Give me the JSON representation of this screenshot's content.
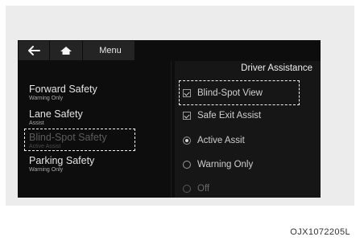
{
  "topbar": {
    "back_icon": "back-arrow-icon",
    "home_icon": "home-icon",
    "menu_label": "Menu"
  },
  "left_menu": [
    {
      "title": "Forward Safety",
      "subtitle": "Warning Only"
    },
    {
      "title": "Lane Safety",
      "subtitle": "Assist"
    },
    {
      "title": "Blind-Spot Safety",
      "subtitle": "Active Assist"
    },
    {
      "title": "Parking Safety",
      "subtitle": "Warning Only"
    }
  ],
  "right_panel": {
    "title": "Driver Assistance",
    "options": [
      {
        "label": "Blind-Spot View",
        "control": "checkbox",
        "checked": true
      },
      {
        "label": "Safe Exit Assist",
        "control": "checkbox",
        "checked": true
      },
      {
        "label": "Active Assit",
        "control": "radio",
        "selected": true
      },
      {
        "label": "Warning Only",
        "control": "radio",
        "selected": false
      },
      {
        "label": "Off",
        "control": "radio",
        "selected": false
      }
    ]
  },
  "figure_code": "OJX1072205L"
}
